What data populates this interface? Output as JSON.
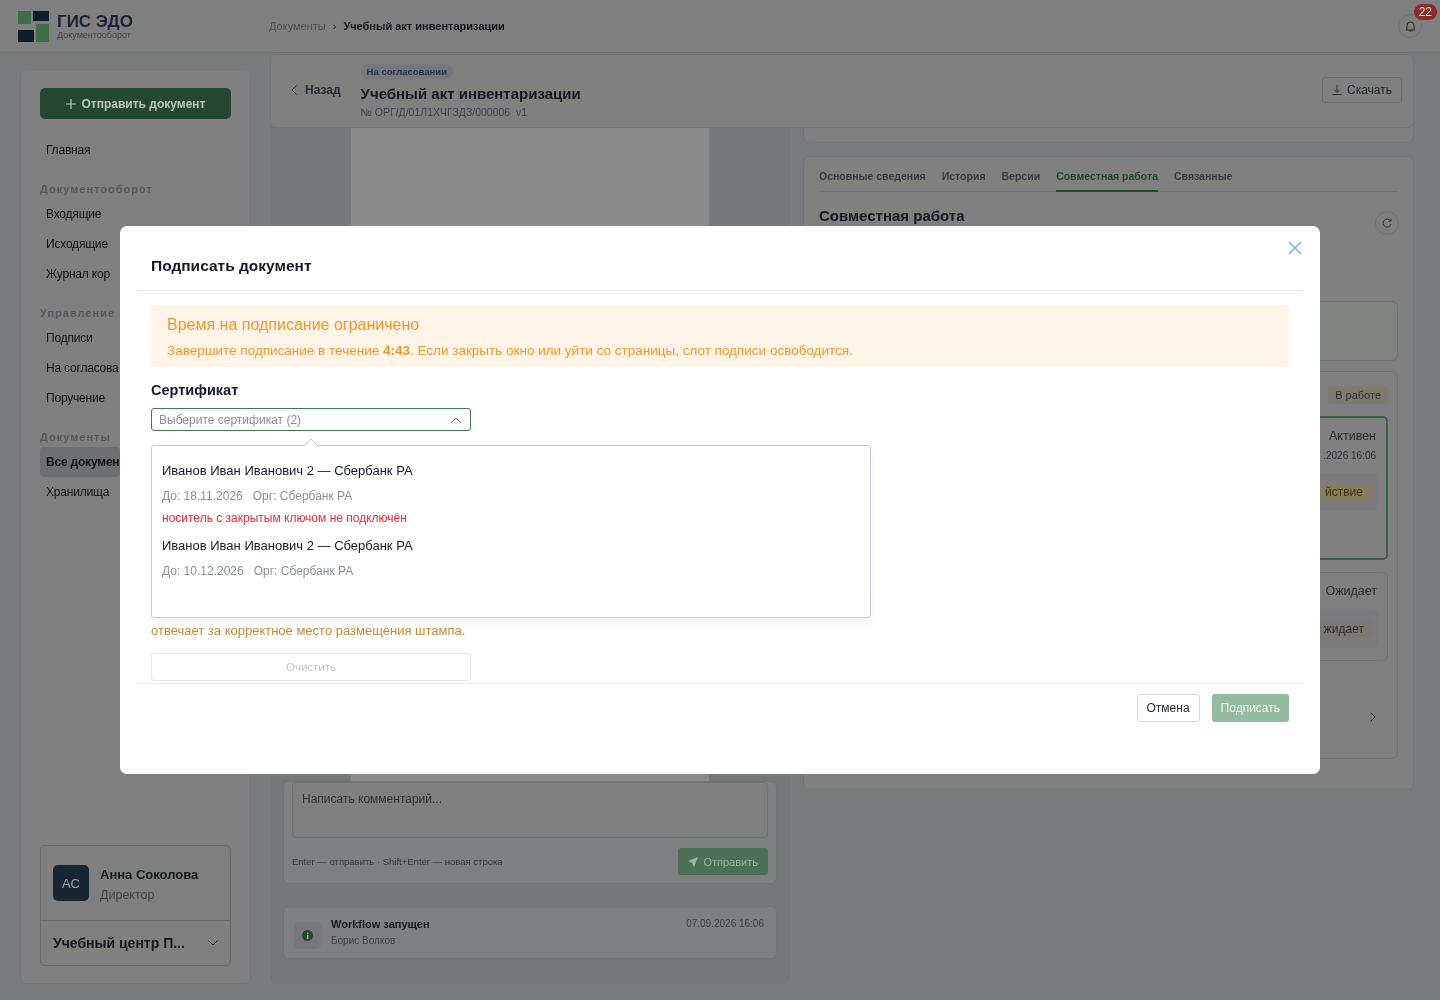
{
  "topbar": {
    "logo_title": "ГИС ЭДО",
    "logo_subtitle": "Документооборот",
    "breadcrumb": [
      {
        "label": "Документы",
        "current": false,
        "separator": "›"
      },
      {
        "label": "Учебный акт инвентаризации",
        "current": true
      }
    ],
    "notifications": "22"
  },
  "sidebar": {
    "action": "Отправить документ",
    "sections": [
      {
        "items": [
          {
            "label": "Главная",
            "selected": false
          }
        ]
      },
      {
        "heading": "Документооборот",
        "items": [
          {
            "label": "Входящие",
            "selected": false
          },
          {
            "label": "Исходящие",
            "selected": false
          },
          {
            "label": "Журнал кор",
            "selected": false
          }
        ]
      },
      {
        "heading": "Управление",
        "items": [
          {
            "label": "Подписи",
            "selected": false
          },
          {
            "label": "На согласова",
            "selected": false
          },
          {
            "label": "Поручение",
            "selected": false
          }
        ]
      },
      {
        "heading": "Документы",
        "items": [
          {
            "label": "Все докумен",
            "selected": true
          },
          {
            "label": "Хранилища",
            "selected": false
          }
        ]
      }
    ],
    "user": {
      "initials": "АС",
      "name": "Анна Соколова",
      "role": "Директор",
      "org": "Учебный центр П..."
    }
  },
  "document": {
    "back": "Назад",
    "status": "На согласовании",
    "title": "Учебный акт инвентаризации",
    "number": "№ ОРГ/Д/01Л1ХЧГЗДЗ/000006  v1",
    "download": "Скачать"
  },
  "comments": {
    "placeholder": "Написать комментарий...",
    "hint": "Enter — отправить · Shift+Enter — новая строка",
    "send": "Отправить"
  },
  "events": [
    {
      "title": "Workflow запущен",
      "author": "Борис Волков",
      "time": "07.09.2026 16:06"
    }
  ],
  "panel": {
    "tabs": [
      {
        "label": "Основные сведения",
        "selected": false
      },
      {
        "label": "История",
        "selected": false
      },
      {
        "label": "Версии",
        "selected": false
      },
      {
        "label": "Совместная работа",
        "selected": true
      },
      {
        "label": "Связанные",
        "selected": false
      }
    ],
    "title": "Совместная работа",
    "workflow_status": "В работе",
    "steps": [
      {
        "status": "Активен",
        "time": ".2026 16:06",
        "action": "йствие",
        "active": true
      },
      {
        "status": "Ожидает",
        "action": "жидает",
        "active": false
      }
    ]
  },
  "modal": {
    "title": "Подписать документ",
    "alert": {
      "title": "Время на подписание ограничено",
      "text": "Завершите подписание в течение **4:43**. Если закрыть окно или уйти со страницы, слот подписи освободится."
    },
    "certificate": {
      "label": "Сертификат",
      "placeholder": "Выберите сертификат (2)",
      "expanded": true,
      "options": [
        {
          "name": "Иванов Иван Иванович 2 — Сбербанк РА",
          "valid_until": "До: 18.11.2026",
          "org": "Орг: Сбербанк РА",
          "error": "носитель с закрытым ключом не подключён"
        },
        {
          "name": "Иванов Иван Иванович 2 — Сбербанк РА",
          "valid_until": "До: 10.12.2026",
          "org": "Орг: Сбербанк РА"
        }
      ]
    },
    "stamp": {
      "note": "отвечает за корректное место размещения штампа.",
      "clear": "Очистить",
      "clear_disabled": true
    },
    "cancel": "Отмена",
    "submit": "Подписать",
    "submit_disabled": true
  }
}
